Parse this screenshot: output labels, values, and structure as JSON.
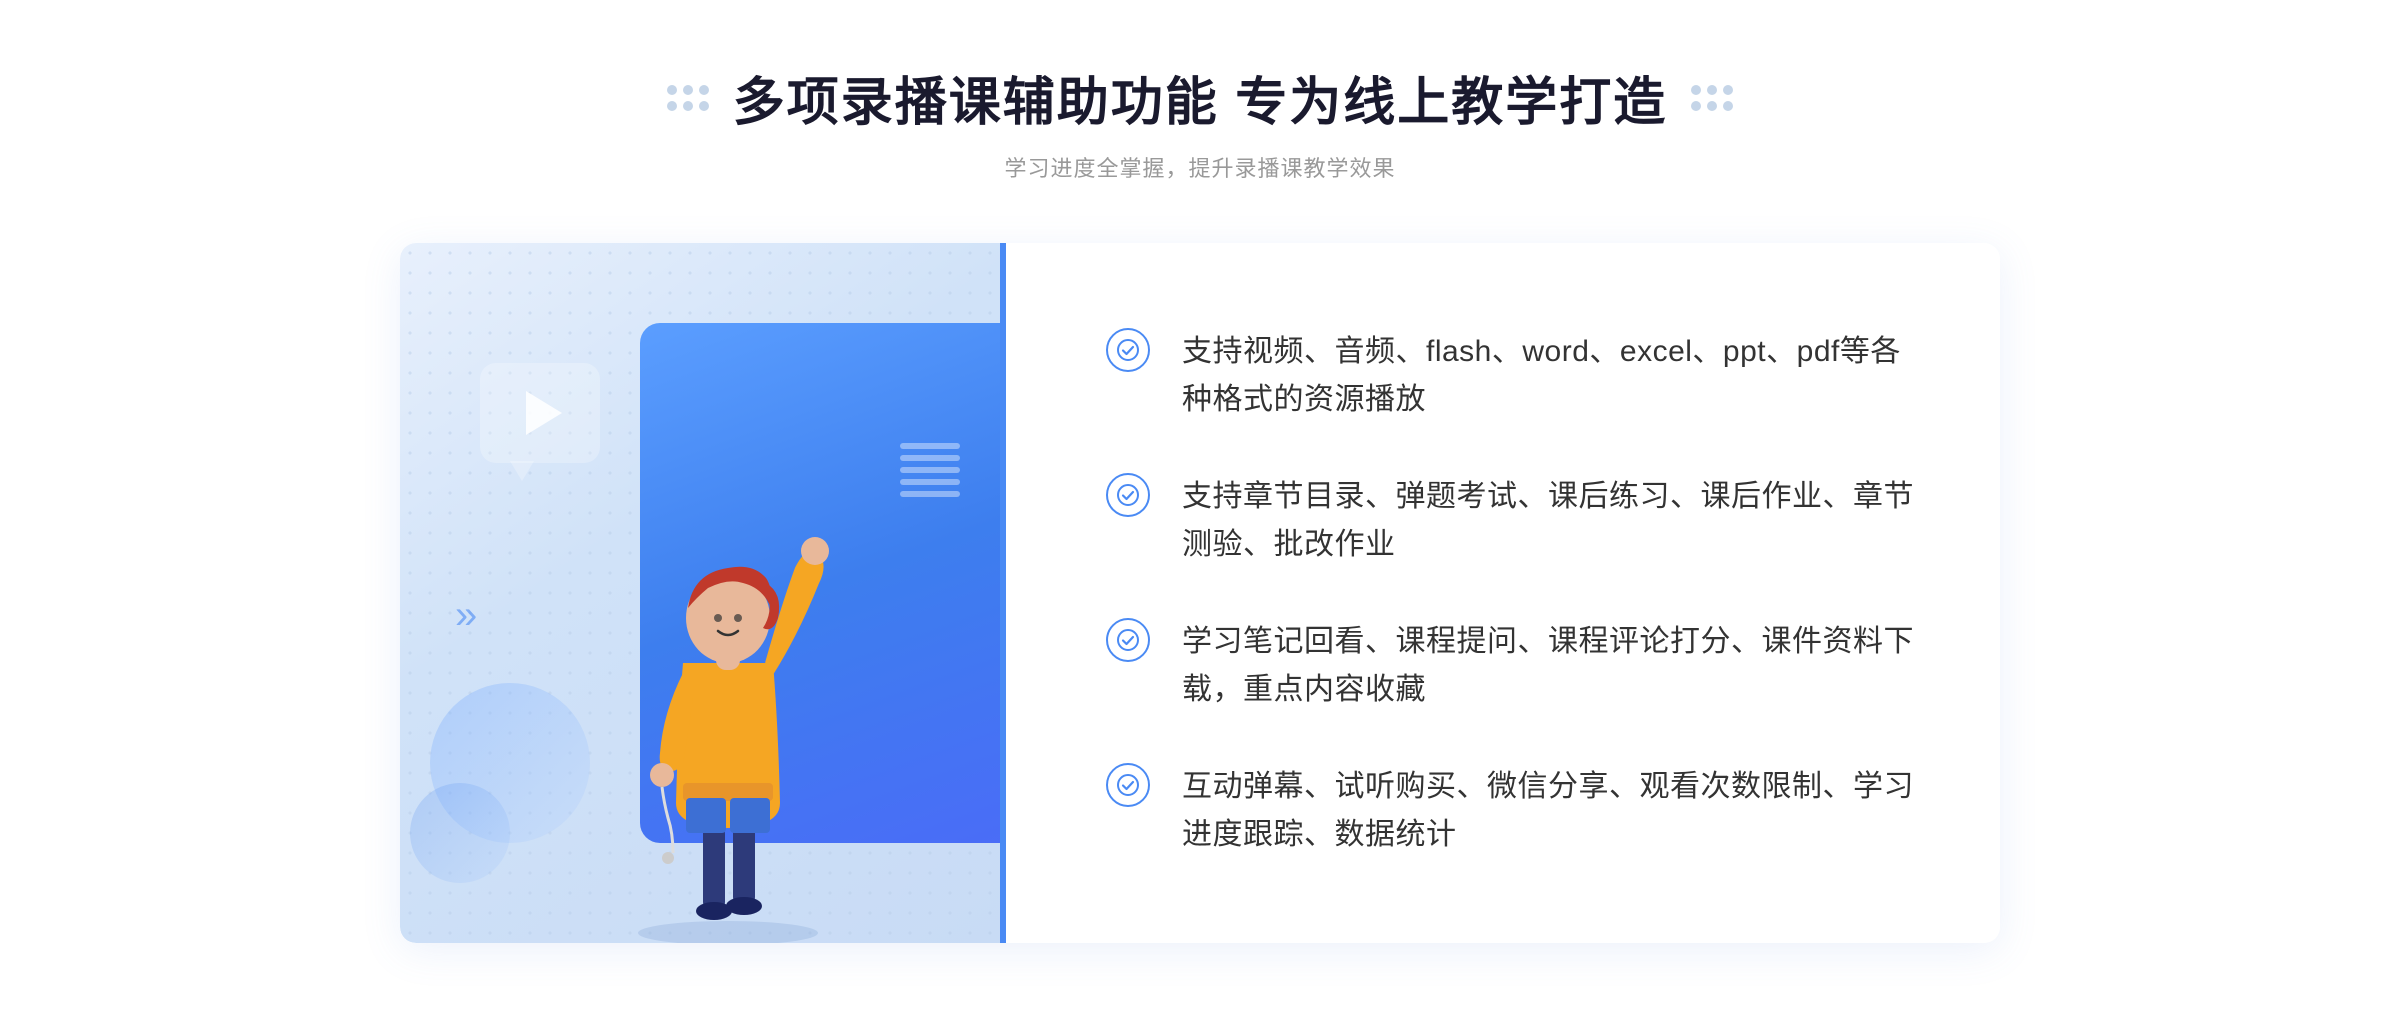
{
  "header": {
    "title": "多项录播课辅助功能 专为线上教学打造",
    "subtitle": "学习进度全掌握，提升录播课教学效果"
  },
  "features": [
    {
      "id": "feature-1",
      "text": "支持视频、音频、flash、word、excel、ppt、pdf等各种格式的资源播放"
    },
    {
      "id": "feature-2",
      "text": "支持章节目录、弹题考试、课后练习、课后作业、章节测验、批改作业"
    },
    {
      "id": "feature-3",
      "text": "学习笔记回看、课程提问、课程评论打分、课件资料下载，重点内容收藏"
    },
    {
      "id": "feature-4",
      "text": "互动弹幕、试听购买、微信分享、观看次数限制、学习进度跟踪、数据统计"
    }
  ],
  "colors": {
    "accent": "#4a8af4",
    "title": "#1a1a2e",
    "subtitle": "#999999",
    "feature_text": "#333333",
    "bg_light": "#f0f5fc"
  },
  "icons": {
    "check": "check-circle-icon",
    "play": "play-icon",
    "chevron_left": "«"
  }
}
